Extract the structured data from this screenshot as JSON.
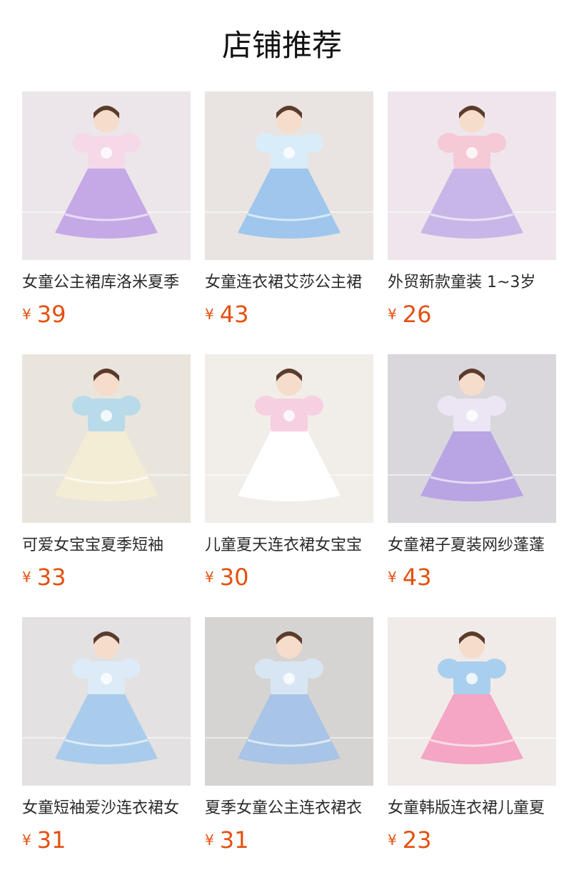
{
  "page": {
    "title": "店铺推荐"
  },
  "currency": "¥",
  "products": [
    {
      "name": "女童公主裙库洛米夏季",
      "price": "39",
      "bg": "#ece6ea",
      "accent": "#c5a9e6",
      "accent2": "#f5d9e9",
      "image": "lavender-princess-dress"
    },
    {
      "name": "女童连衣裙艾莎公主裙",
      "price": "43",
      "bg": "#e9e4e1",
      "accent": "#9fc6ec",
      "accent2": "#d9ecf9",
      "image": "blue-sequin-dress"
    },
    {
      "name": "外贸新款童装 1~3岁",
      "price": "26",
      "bg": "#eee6ec",
      "accent": "#c9b6e8",
      "accent2": "#f6c9d6",
      "image": "two-mini-dresses"
    },
    {
      "name": "可爱女宝宝夏季短袖",
      "price": "33",
      "bg": "#e9e5dd",
      "accent": "#f4edd6",
      "accent2": "#b9dbe9",
      "image": "cream-tulle-dress"
    },
    {
      "name": "儿童夏天连衣裙女宝宝",
      "price": "30",
      "bg": "#f1ede8",
      "accent": "#ffffff",
      "accent2": "#f6cfe0",
      "image": "hello-kitty-dresses"
    },
    {
      "name": "女童裙子夏装网纱蓬蓬",
      "price": "43",
      "bg": "#d9d7dc",
      "accent": "#b9a4e4",
      "accent2": "#ece6f4",
      "image": "purple-tutu-set"
    },
    {
      "name": "女童短袖爱沙连衣裙女",
      "price": "31",
      "bg": "#e3e1e2",
      "accent": "#a9ccec",
      "accent2": "#dcebf7",
      "image": "elsa-blue-dress"
    },
    {
      "name": "夏季女童公主连衣裙衣",
      "price": "31",
      "bg": "#d6d4d2",
      "accent": "#a8c4e6",
      "accent2": "#d8e6f4",
      "image": "crown-blue-dress"
    },
    {
      "name": "女童韩版连衣裙儿童夏",
      "price": "23",
      "bg": "#f0ebe9",
      "accent": "#f4a6c4",
      "accent2": "#a8cfee",
      "image": "pink-elsa-dress"
    }
  ]
}
